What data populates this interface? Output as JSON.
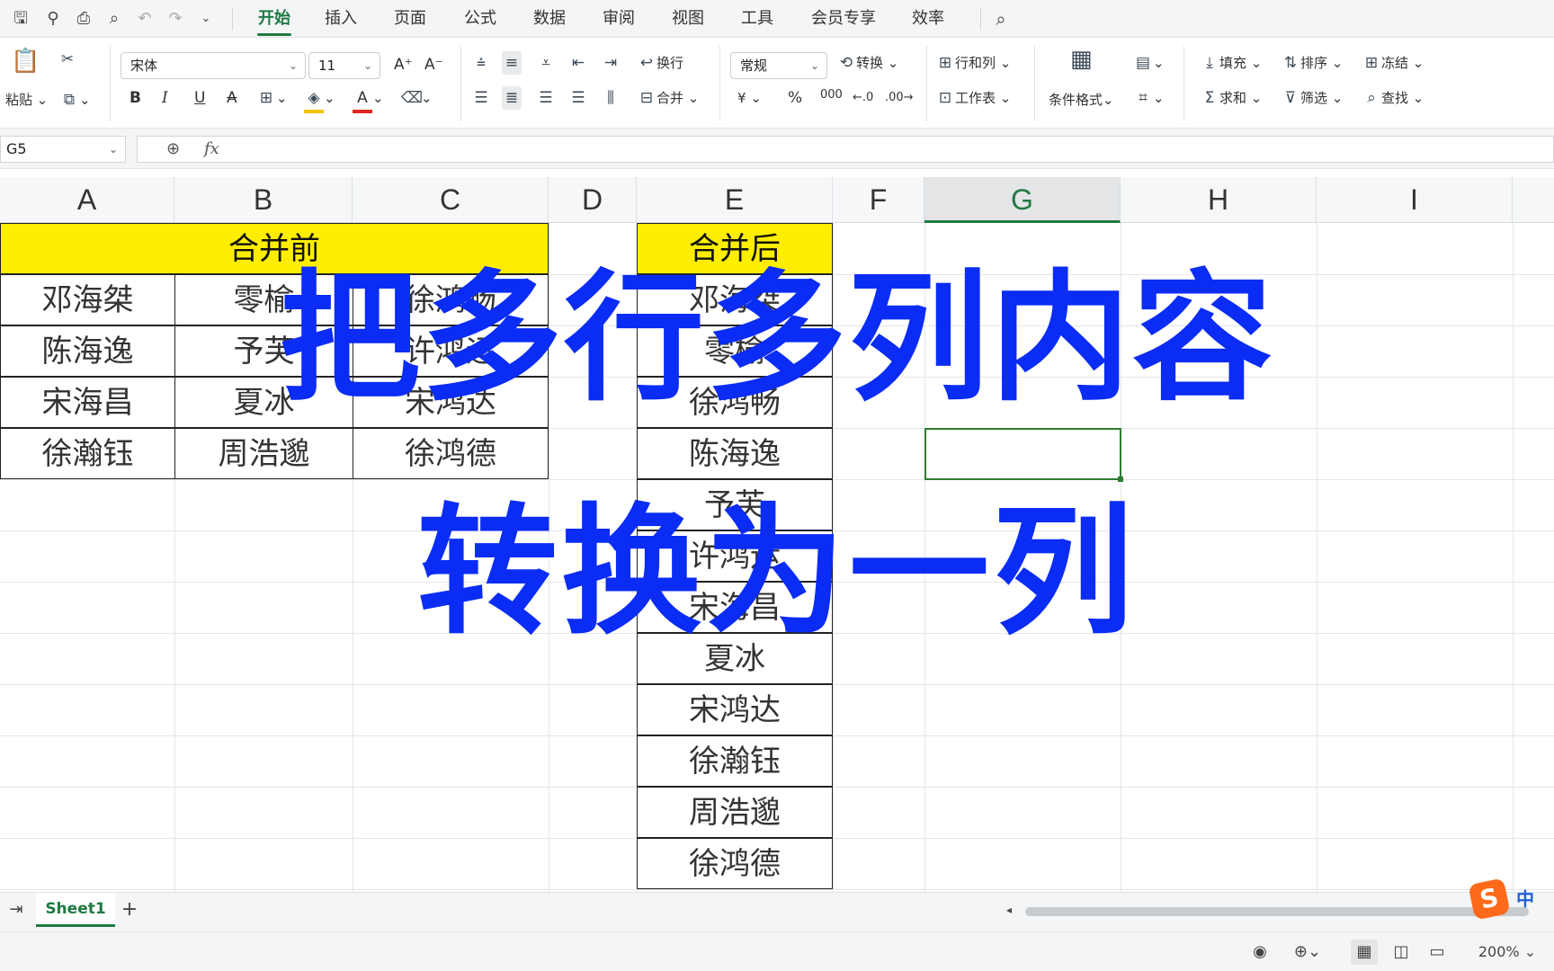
{
  "menu": {
    "tabs": [
      "开始",
      "插入",
      "页面",
      "公式",
      "数据",
      "审阅",
      "视图",
      "工具",
      "会员专享",
      "效率"
    ]
  },
  "ribbon": {
    "paste": "粘贴",
    "font_name": "宋体",
    "font_size": "11",
    "grow": "A⁺",
    "shrink": "A⁻",
    "bold": "B",
    "italic": "I",
    "underline": "U",
    "strike": "A",
    "wrap": "换行",
    "merge": "合并",
    "number_format": "常规",
    "convert": "转换",
    "currency": "¥",
    "percent": "%",
    "thousands": "000",
    "rows_cols": "行和列",
    "worksheet": "工作表",
    "cond_format": "条件格式",
    "fill": "填充",
    "sort": "排序",
    "freeze": "冻结",
    "sum": "求和",
    "filter": "筛选",
    "find": "查找"
  },
  "formula_bar": {
    "name_box": "G5",
    "fx": "fx",
    "content": ""
  },
  "columns": [
    "A",
    "B",
    "C",
    "D",
    "E",
    "F",
    "G",
    "H",
    "I"
  ],
  "selected_column": "G",
  "before": {
    "header": "合并前",
    "rows": [
      [
        "邓海桀",
        "零榆",
        "徐鸿畅"
      ],
      [
        "陈海逸",
        "予芙",
        "许鸿运"
      ],
      [
        "宋海昌",
        "夏冰",
        "宋鸿达"
      ],
      [
        "徐瀚钰",
        "周浩邈",
        "徐鸿德"
      ]
    ]
  },
  "after": {
    "header": "合并后",
    "values": [
      "邓海桀",
      "零榆",
      "徐鸿畅",
      "陈海逸",
      "予芙",
      "许鸿运",
      "宋海昌",
      "夏冰",
      "宋鸿达",
      "徐瀚钰",
      "周浩邈",
      "徐鸿德"
    ]
  },
  "overlay": {
    "line1": "把多行多列内容",
    "line2": "转换为一列",
    "color": "#0a2cf5"
  },
  "sheets": {
    "active": "Sheet1",
    "add": "+"
  },
  "status": {
    "zoom": "200%"
  },
  "ime": {
    "logo": "S",
    "mode": "中"
  },
  "colors": {
    "accent": "#1f7a43",
    "header_fill": "#ffee00"
  }
}
